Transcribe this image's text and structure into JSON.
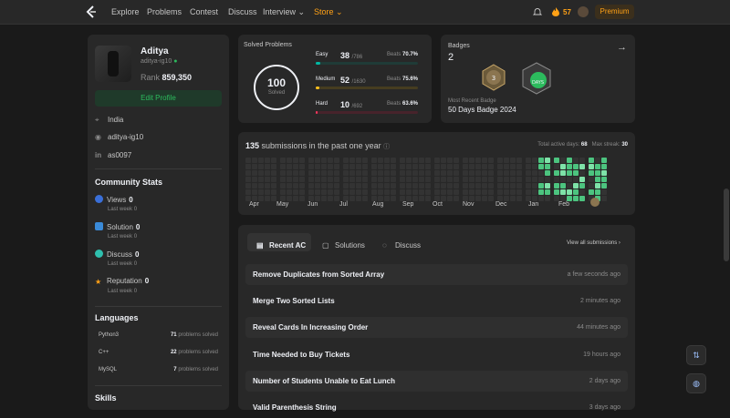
{
  "nav": {
    "logo": "leetcode-logo",
    "links": [
      "Explore",
      "Problems",
      "Contest",
      "Discuss",
      "Interview ⌄",
      "Store ⌄"
    ],
    "streak": "57",
    "premium": "Premium",
    "colors": {
      "accent": "#ffa116",
      "easy": "#00b8a3",
      "medium": "#ffc01e",
      "hard": "#ff375f",
      "green": "#2cbb5d"
    }
  },
  "profile": {
    "name": "Aditya",
    "handle": "aditya-ig10",
    "rank_label": "Rank",
    "rank": "859,350",
    "edit": "Edit Profile",
    "location": "India",
    "github": "aditya-ig10",
    "linkedin": "as0097"
  },
  "community": {
    "title": "Community Stats",
    "items": [
      {
        "label": "Views",
        "value": "0",
        "sub": "Last week",
        "subv": "0"
      },
      {
        "label": "Solution",
        "value": "0",
        "sub": "Last week",
        "subv": "0"
      },
      {
        "label": "Discuss",
        "value": "0",
        "sub": "Last week",
        "subv": "0"
      },
      {
        "label": "Reputation",
        "value": "0",
        "sub": "Last week",
        "subv": "0"
      }
    ]
  },
  "languages": {
    "title": "Languages",
    "items": [
      {
        "name": "Python3",
        "count": "71",
        "unit": "problems solved"
      },
      {
        "name": "C++",
        "count": "22",
        "unit": "problems solved"
      },
      {
        "name": "MySQL",
        "count": "7",
        "unit": "problems solved"
      }
    ]
  },
  "skills": {
    "title": "Skills"
  },
  "solved": {
    "title": "Solved Problems",
    "total": "100",
    "total_label": "Solved",
    "difficulties": [
      {
        "name": "Easy",
        "count": "38",
        "of": "/786",
        "beats_label": "Beats",
        "beats": "70.7%",
        "fraction": 0.048
      },
      {
        "name": "Medium",
        "count": "52",
        "of": "/1630",
        "beats_label": "Beats",
        "beats": "75.6%",
        "fraction": 0.032
      },
      {
        "name": "Hard",
        "count": "10",
        "of": "/692",
        "beats_label": "Beats",
        "beats": "63.6%",
        "fraction": 0.014
      }
    ]
  },
  "badges": {
    "title": "Badges",
    "count": "2",
    "recent_label": "Most Recent Badge",
    "recent_name": "50 Days Badge 2024"
  },
  "calendar": {
    "count": "135",
    "title_suffix": "submissions in the past one year",
    "active_label": "Total active days:",
    "active": "68",
    "streak_label": "Max streak:",
    "streak": "30",
    "months": [
      "Apr",
      "May",
      "Jun",
      "Jul",
      "Aug",
      "Sep",
      "Oct",
      "Nov",
      "Dec",
      "Jan",
      "Feb",
      "Mar"
    ]
  },
  "submissions": {
    "tabs": [
      "Recent AC",
      "Solutions",
      "Discuss"
    ],
    "view_all": "View all submissions",
    "rows": [
      {
        "title": "Remove Duplicates from Sorted Array",
        "time": "a few seconds ago"
      },
      {
        "title": "Merge Two Sorted Lists",
        "time": "2 minutes ago"
      },
      {
        "title": "Reveal Cards In Increasing Order",
        "time": "44 minutes ago"
      },
      {
        "title": "Time Needed to Buy Tickets",
        "time": "19 hours ago"
      },
      {
        "title": "Number of Students Unable to Eat Lunch",
        "time": "2 days ago"
      },
      {
        "title": "Valid Parenthesis String",
        "time": "3 days ago"
      }
    ]
  }
}
